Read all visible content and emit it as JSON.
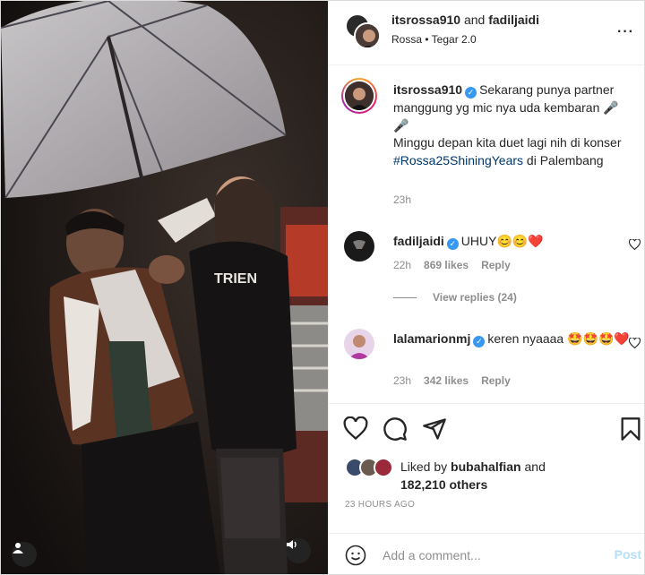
{
  "header": {
    "user1": "itsrossa910",
    "and_text": "and",
    "user2": "fadiljaidi",
    "subtitle": "Rossa • Tegar 2.0",
    "more_icon": "more-horizontal-icon"
  },
  "caption": {
    "username": "itsrossa910",
    "text1": "Sekarang punya partner manggung yg mic nya uda kembaran 🎤🎤",
    "text2_pre": "Minggu depan kita duet lagi nih di konser ",
    "hashtag": "#Rossa25ShiningYears",
    "text2_post": " di Palembang",
    "time": "23h"
  },
  "comments": [
    {
      "username": "fadiljaidi",
      "text": "UHUY😊😊❤️",
      "time": "22h",
      "likes": "869 likes",
      "reply": "Reply"
    },
    {
      "username": "lalamarionmj",
      "text": "keren nyaaaa 🤩🤩🤩❤️",
      "time": "23h",
      "likes": "342 likes",
      "reply": "Reply"
    }
  ],
  "view_replies": "View replies (24)",
  "actions": {
    "like_icon": "heart-icon",
    "comment_icon": "comment-icon",
    "share_icon": "send-icon",
    "save_icon": "bookmark-icon"
  },
  "likes": {
    "prefix": "Liked by ",
    "user": "bubahalfian",
    "and_text": " and",
    "count": "182,210 others"
  },
  "time_ago": "23 HOURS AGO",
  "comment_box": {
    "placeholder": "Add a comment...",
    "post_label": "Post",
    "emoji_icon": "smiley-icon"
  },
  "media": {
    "user_tag_icon": "user-icon",
    "mute_icon": "speaker-icon"
  },
  "colors": {
    "link": "#00376b",
    "verified": "#3897f0",
    "muted": "#8e8e8e",
    "post_disabled": "#b2dffc"
  }
}
